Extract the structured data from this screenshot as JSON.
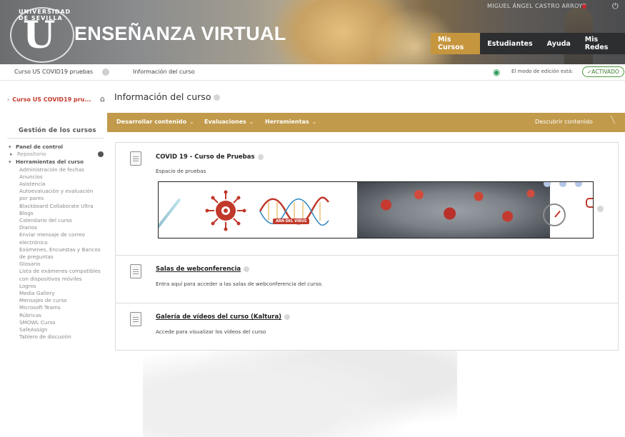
{
  "header": {
    "brand": "ENSEÑANZA VIRTUAL",
    "logo_letter": "U",
    "logo_ring_text": "UNIVERSIDAD DE SEVILLA",
    "user_name": "MIGUEL ÁNGEL CASTRO ARROYO",
    "nav": [
      {
        "label": "Mis Cursos",
        "active": true
      },
      {
        "label": "Estudiantes",
        "active": false
      },
      {
        "label": "Ayuda",
        "active": false
      },
      {
        "label": "Mis Redes",
        "active": false
      }
    ],
    "colors": {
      "nav_active": "#c6963e",
      "nav_bg": "#2d2e30"
    }
  },
  "breadcrumb": {
    "course": "Curso US COVID19 pruebas",
    "page": "Información del curso",
    "edit_mode_label": "El modo de edición está:",
    "edit_mode_value": "ACTIVADO"
  },
  "sidebar": {
    "course_name": "Curso US COVID19 pru...",
    "section_heading": "Gestión de los cursos",
    "items": [
      {
        "label": "Panel de control",
        "kind": "group",
        "marker": "▾"
      },
      {
        "label": "Repositorio",
        "kind": "sub",
        "marker": "▸",
        "gear": true
      },
      {
        "label": "Herramientas del curso",
        "kind": "group",
        "marker": "▾"
      },
      {
        "label": "Administración de fechas",
        "kind": "leaf"
      },
      {
        "label": "Anuncios",
        "kind": "leaf"
      },
      {
        "label": "Asistencia",
        "kind": "leaf"
      },
      {
        "label": "Autoevaluación y evaluación por pares",
        "kind": "leaf"
      },
      {
        "label": "Blackboard Collaborate Ultra",
        "kind": "leaf"
      },
      {
        "label": "Blogs",
        "kind": "leaf"
      },
      {
        "label": "Calendario del curso",
        "kind": "leaf"
      },
      {
        "label": "Diarios",
        "kind": "leaf"
      },
      {
        "label": "Enviar mensaje de correo electrónico",
        "kind": "leaf"
      },
      {
        "label": "Exámenes, Encuestas y Bancos de preguntas",
        "kind": "leaf"
      },
      {
        "label": "Glosario",
        "kind": "leaf"
      },
      {
        "label": "Lista de exámenes compatibles con dispositivos móviles",
        "kind": "leaf"
      },
      {
        "label": "Logros",
        "kind": "leaf"
      },
      {
        "label": "Media Gallery",
        "kind": "leaf"
      },
      {
        "label": "Mensajes de curso",
        "kind": "leaf"
      },
      {
        "label": "Microsoft Teams",
        "kind": "leaf"
      },
      {
        "label": "Rúbricas",
        "kind": "leaf"
      },
      {
        "label": "SMOWL Curso",
        "kind": "leaf"
      },
      {
        "label": "SafeAssign",
        "kind": "leaf"
      },
      {
        "label": "Tablero de discusión",
        "kind": "leaf"
      }
    ]
  },
  "main": {
    "title": "Información del curso",
    "actionbar": {
      "items": [
        "Desarrollar contenido",
        "Evaluaciones",
        "Herramientas"
      ],
      "discover": "Descubrir contenido"
    },
    "content_items": [
      {
        "title": "COVID 19 - Curso de Pruebas",
        "description": "Espacio de pruebas",
        "link": false
      },
      {
        "title": "Salas de webconferencia",
        "description": "Entra aquí para acceder a las salas de webconferencia del curso.",
        "link": true
      },
      {
        "title": "Galería de vídeos del curso (Kaltura)",
        "description": "Accede para visualizar los vídeos del curso",
        "link": true
      }
    ],
    "banner": {
      "rna_label": "ARN DEL VIRUS"
    }
  }
}
